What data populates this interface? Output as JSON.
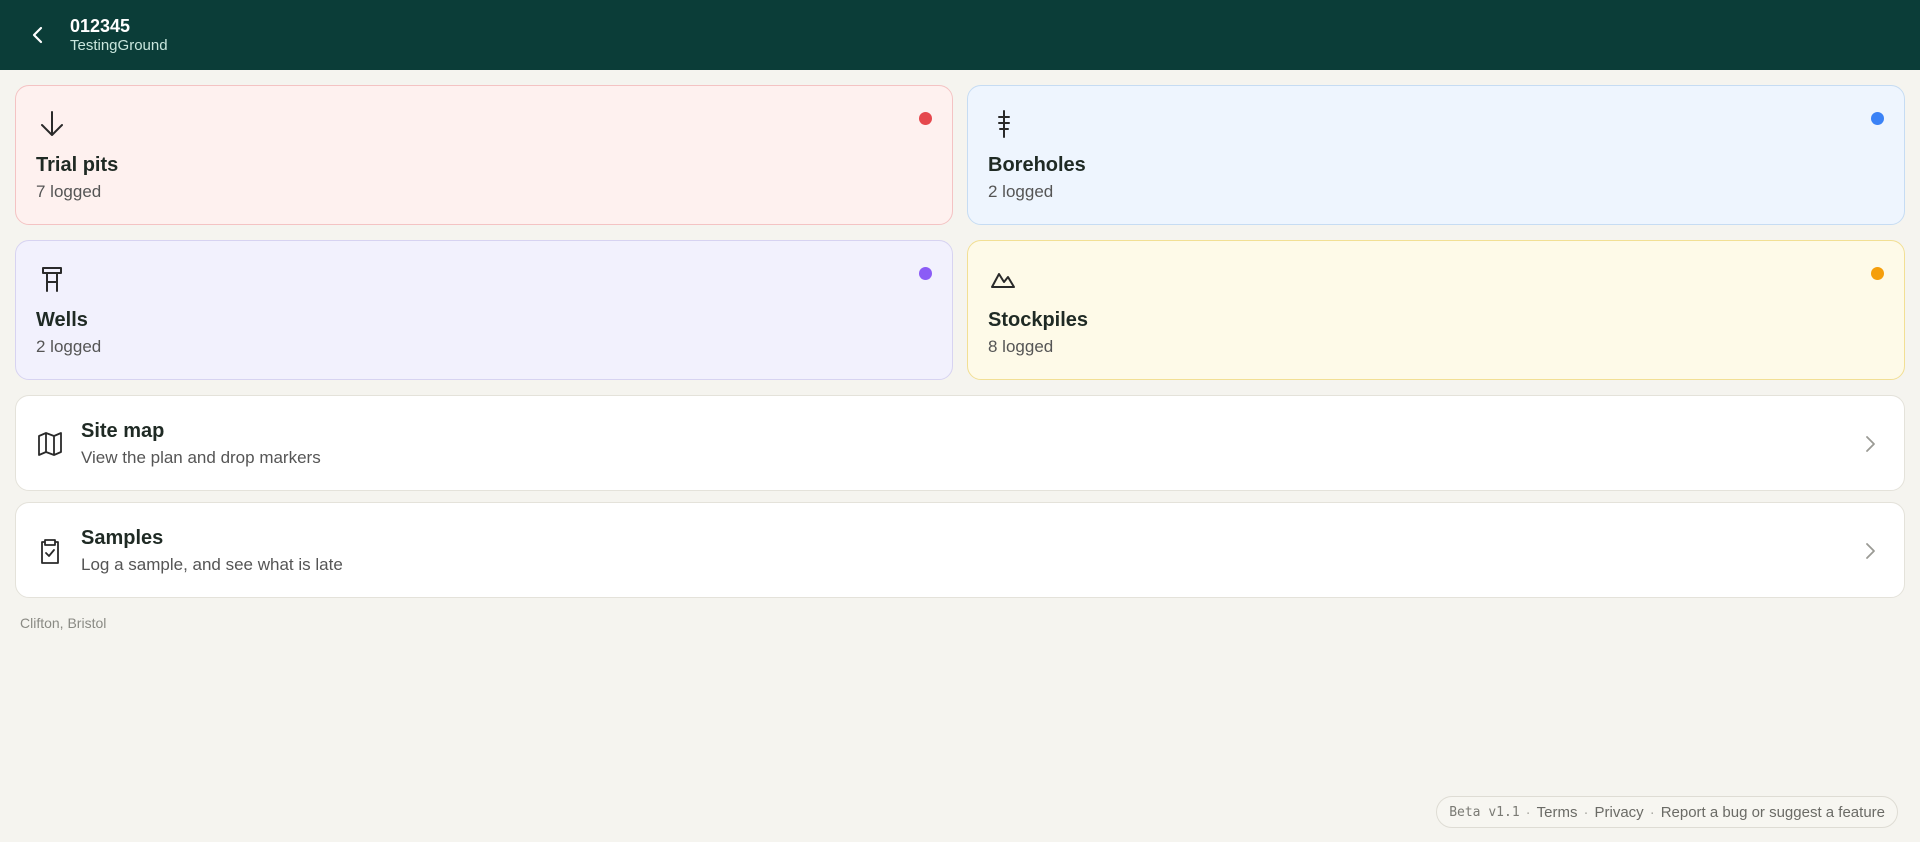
{
  "header": {
    "project_code": "012345",
    "project_name": "TestingGround",
    "back_icon": "chevron-left-icon"
  },
  "cards": {
    "trial_pits": {
      "title": "Trial pits",
      "count": "7 logged",
      "icon": "arrow-down-icon",
      "dot_color": "#e5484d"
    },
    "boreholes": {
      "title": "Boreholes",
      "count": "2 logged",
      "icon": "borehole-icon",
      "dot_color": "#3b82f6"
    },
    "wells": {
      "title": "Wells",
      "count": "2 logged",
      "icon": "well-icon",
      "dot_color": "#8b5cf6"
    },
    "stockpiles": {
      "title": "Stockpiles",
      "count": "8 logged",
      "icon": "mountain-icon",
      "dot_color": "#f59e0b"
    }
  },
  "rows": {
    "site_map": {
      "title": "Site map",
      "subtitle": "View the plan and drop markers",
      "icon": "map-icon"
    },
    "samples": {
      "title": "Samples",
      "subtitle": "Log a sample, and see what is late",
      "icon": "clipboard-check-icon"
    }
  },
  "location": "Clifton, Bristol",
  "footer": {
    "version": "Beta v1.1",
    "separator": "·",
    "terms": "Terms",
    "privacy": "Privacy",
    "report": "Report a bug or suggest a feature"
  }
}
